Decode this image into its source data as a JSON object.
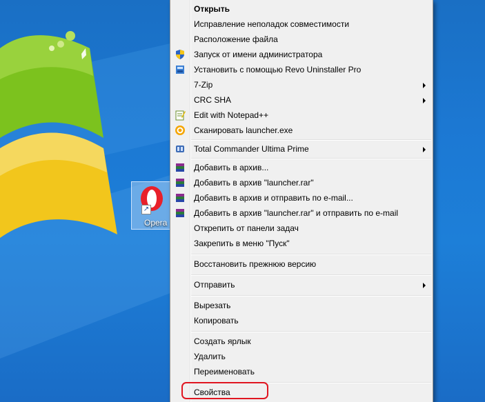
{
  "desktop": {
    "shortcut_label": "Opera"
  },
  "menu": {
    "open": "Открыть",
    "troubleshoot": "Исправление неполадок совместимости",
    "file_location": "Расположение файла",
    "run_as_admin": "Запуск от имени администратора",
    "revo": "Установить с помощью Revo Uninstaller Pro",
    "sevenzip": "7-Zip",
    "crcsha": "CRC SHA",
    "notepad": "Edit with Notepad++",
    "scan": "Сканировать launcher.exe",
    "total_commander": "Total Commander Ultima Prime",
    "add_archive": "Добавить в архив...",
    "add_archive_named": "Добавить в архив \"launcher.rar\"",
    "add_email": "Добавить в архив и отправить по e-mail...",
    "add_email_named": "Добавить в архив \"launcher.rar\" и отправить по e-mail",
    "unpin_taskbar": "Открепить от панели задач",
    "pin_start": "Закрепить в меню \"Пуск\"",
    "restore": "Восстановить прежнюю версию",
    "send_to": "Отправить",
    "cut": "Вырезать",
    "copy": "Копировать",
    "create_shortcut": "Создать ярлык",
    "delete": "Удалить",
    "rename": "Переименовать",
    "properties": "Свойства"
  },
  "colors": {
    "highlight_ring": "#e01520",
    "menu_bg": "#f0f0f0",
    "desktop_blue": "#1c79d4"
  }
}
